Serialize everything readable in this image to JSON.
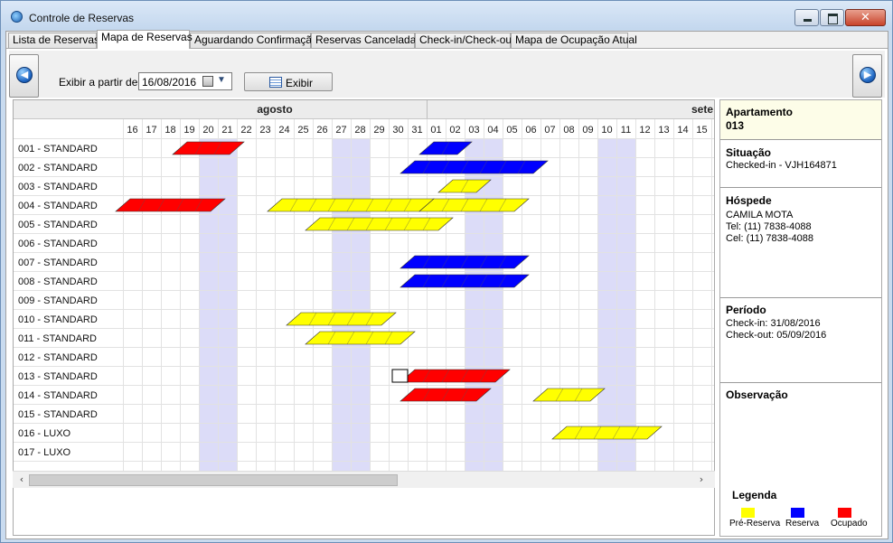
{
  "window": {
    "title": "Controle de Reservas",
    "controls": {
      "close": "✕"
    }
  },
  "tabs": [
    {
      "label": "Lista de Reservas",
      "active": false
    },
    {
      "label": "Mapa de Reservas",
      "active": true
    },
    {
      "label": "Aguardando Confirmação",
      "active": false
    },
    {
      "label": "Reservas Canceladas",
      "active": false
    },
    {
      "label": "Check-in/Check-out",
      "active": false
    },
    {
      "label": "Mapa de Ocupação Atual",
      "active": false
    }
  ],
  "toolbar": {
    "date_label": "Exibir a partir de:",
    "date_value": "16/08/2016",
    "show_button": "Exibir",
    "prev_icon": "arrow-left-icon",
    "next_icon": "arrow-right-icon"
  },
  "grid": {
    "months": [
      {
        "label": "agosto"
      },
      {
        "label": "sete"
      }
    ],
    "days": [
      "16",
      "17",
      "18",
      "19",
      "20",
      "21",
      "22",
      "23",
      "24",
      "25",
      "26",
      "27",
      "28",
      "29",
      "30",
      "31",
      "01",
      "02",
      "03",
      "04",
      "05",
      "06",
      "07",
      "08",
      "09",
      "10",
      "11",
      "12",
      "13",
      "14",
      "15"
    ],
    "weekend_day_index": [
      4,
      5,
      11,
      12,
      18,
      19,
      25,
      26
    ],
    "rooms": [
      "001 - STANDARD",
      "002 - STANDARD",
      "003 - STANDARD",
      "004 - STANDARD",
      "005 - STANDARD",
      "006 - STANDARD",
      "007 - STANDARD",
      "008 - STANDARD",
      "009 - STANDARD",
      "010 - STANDARD",
      "011 - STANDARD",
      "012 - STANDARD",
      "013 - STANDARD",
      "014 - STANDARD",
      "015 - STANDARD",
      "016 - LUXO",
      "017 - LUXO"
    ],
    "reservations": [
      {
        "room": 0,
        "start": 3,
        "end": 6,
        "status": "ocupado"
      },
      {
        "room": 0,
        "start": 16,
        "end": 18,
        "status": "reserva"
      },
      {
        "room": 1,
        "start": 15,
        "end": 22,
        "status": "reserva"
      },
      {
        "room": 2,
        "start": 17,
        "end": 19,
        "status": "pre"
      },
      {
        "room": 3,
        "start": 0,
        "end": 5,
        "status": "ocupado"
      },
      {
        "room": 3,
        "start": 8,
        "end": 16,
        "status": "pre"
      },
      {
        "room": 3,
        "start": 16,
        "end": 21,
        "status": "pre"
      },
      {
        "room": 4,
        "start": 10,
        "end": 17,
        "status": "pre"
      },
      {
        "room": 6,
        "start": 15,
        "end": 21,
        "status": "reserva"
      },
      {
        "room": 7,
        "start": 15,
        "end": 21,
        "status": "reserva"
      },
      {
        "room": 9,
        "start": 9,
        "end": 14,
        "status": "pre"
      },
      {
        "room": 10,
        "start": 10,
        "end": 15,
        "status": "pre"
      },
      {
        "room": 12,
        "start": 15,
        "end": 20,
        "status": "ocupado",
        "selected": true
      },
      {
        "room": 13,
        "start": 15,
        "end": 19,
        "status": "ocupado"
      },
      {
        "room": 13,
        "start": 22,
        "end": 25,
        "status": "pre"
      },
      {
        "room": 15,
        "start": 23,
        "end": 28,
        "status": "pre"
      }
    ]
  },
  "details": {
    "apartment": {
      "title": "Apartamento",
      "value": "013"
    },
    "situation": {
      "title": "Situação",
      "value": "Checked-in - VJH164871"
    },
    "guest": {
      "title": "Hóspede",
      "name": "CAMILA MOTA",
      "tel": "Tel: (11) 7838-4088",
      "cel": "Cel: (11) 7838-4088"
    },
    "period": {
      "title": "Período",
      "checkin": "Check-in: 31/08/2016",
      "checkout": "Check-out: 05/09/2016"
    },
    "observation": {
      "title": "Observação"
    }
  },
  "legend": {
    "title": "Legenda",
    "items": [
      {
        "label": "Pré-Reserva",
        "color": "#ffff00"
      },
      {
        "label": "Reserva",
        "color": "#0000ff"
      },
      {
        "label": "Ocupado",
        "color": "#ff0000"
      }
    ]
  },
  "colors": {
    "pre": "#ffff00",
    "reserva": "#0000ff",
    "ocupado": "#ff0000",
    "weekend": "#dcdcf8"
  }
}
